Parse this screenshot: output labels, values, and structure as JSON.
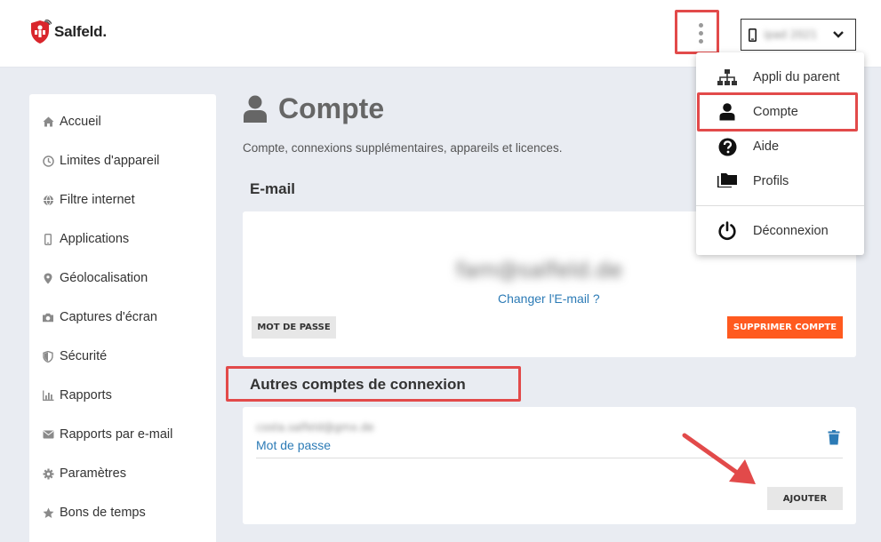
{
  "header": {
    "logo_text": "Salfeld.",
    "device_name": "ipad 2021"
  },
  "sidebar": {
    "items": [
      {
        "label": "Accueil",
        "icon": "home-icon"
      },
      {
        "label": "Limites d'appareil",
        "icon": "clock-icon"
      },
      {
        "label": "Filtre internet",
        "icon": "globe-icon"
      },
      {
        "label": "Applications",
        "icon": "phone-icon"
      },
      {
        "label": "Géolocalisation",
        "icon": "map-pin-icon"
      },
      {
        "label": "Captures d'écran",
        "icon": "camera-icon"
      },
      {
        "label": "Sécurité",
        "icon": "shield-icon"
      },
      {
        "label": "Rapports",
        "icon": "bar-chart-icon"
      },
      {
        "label": "Rapports par e-mail",
        "icon": "envelope-icon"
      },
      {
        "label": "Paramètres",
        "icon": "gear-icon"
      },
      {
        "label": "Bons de temps",
        "icon": "star-icon"
      }
    ]
  },
  "main": {
    "title": "Compte",
    "description": "Compte, connexions supplémentaires, appareils et licences.",
    "email_section": {
      "title": "E-mail",
      "email": "fam@salfeld.de",
      "change_link": "Changer l'E-mail ?",
      "password_button": "MOT DE PASSE",
      "delete_button": "SUPPRIMER COMPTE"
    },
    "other_accounts": {
      "title": "Autres comptes de connexion",
      "account_email": "costa.salfeld@gmx.de",
      "password_link": "Mot de passe",
      "add_button": "AJOUTER"
    }
  },
  "dropdown": {
    "items": [
      {
        "label": "Appli du parent",
        "icon": "sitemap-icon"
      },
      {
        "label": "Compte",
        "icon": "user-icon"
      },
      {
        "label": "Aide",
        "icon": "question-circle-icon"
      },
      {
        "label": "Profils",
        "icon": "folders-icon"
      },
      {
        "label": "Déconnexion",
        "icon": "power-icon"
      }
    ]
  },
  "colors": {
    "accent_link": "#2c7bb6",
    "danger_button": "#ff5a1f",
    "highlight": "#e24a4a",
    "logo_red": "#d9262c"
  }
}
